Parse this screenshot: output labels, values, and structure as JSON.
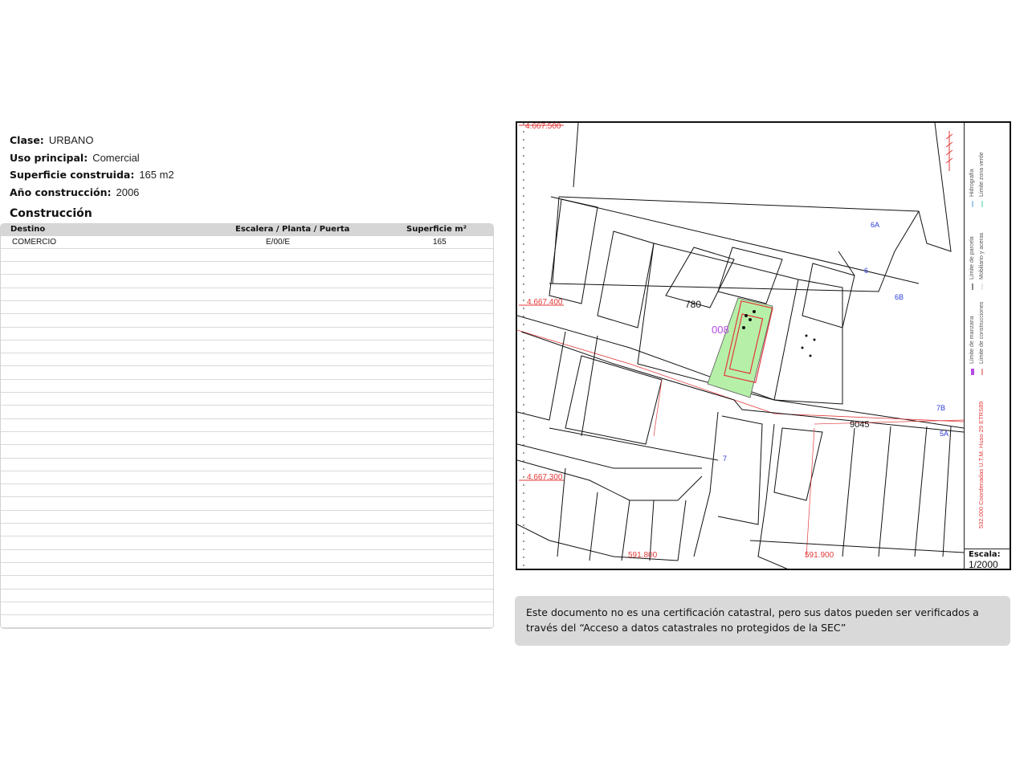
{
  "properties": [
    {
      "label": "Clase:",
      "value": "URBANO"
    },
    {
      "label": "Uso principal:",
      "value": "Comercial"
    },
    {
      "label": "Superficie construida:",
      "value": "165 m2"
    },
    {
      "label": "Año construcción:",
      "value": "2006"
    }
  ],
  "construccion": {
    "title": "Construcción",
    "headers": {
      "destino": "Destino",
      "escalera": "Escalera / Planta / Puerta",
      "superficie": "Superficie m²"
    },
    "rows": [
      {
        "destino": "COMERCIO",
        "escalera": "E/00/E",
        "superficie": "165"
      }
    ]
  },
  "map": {
    "coord_labels": {
      "y_top": "4.667.500",
      "y_mid": "4.667.400",
      "y_low": "4.667.300",
      "x_left": "591.800",
      "x_right": "591.900"
    },
    "parcel_labels": {
      "main_parcel": "780",
      "neighbor_parcel": "9045",
      "parcel_ref": "008",
      "num_6a": "6A",
      "num_6b": "6B",
      "num_7b": "7B",
      "num_5a": "5A",
      "num_6": "6",
      "num_7": "7"
    },
    "legend": [
      "Límite de manzana",
      "Límite de parcela",
      "Hidrografía",
      "Límite de construcciones",
      "Mobiliario y aceras",
      "Límite zona verde"
    ],
    "coordinates_note": "532.000 Coordenadas U.T.M. Huso 29 ETRS89",
    "scale_label": "Escala:",
    "scale_value": "1/2000",
    "colors": {
      "parcel_fill": "#b6f0a8",
      "red_lines": "#e23a3a",
      "blue_labels": "#2a3bd6",
      "purple": "#b54be3"
    }
  },
  "notice": "Este documento no es una certificación catastral, pero sus datos pueden ser verificados a través del “Acceso a datos catastrales no protegidos de la SEC”"
}
